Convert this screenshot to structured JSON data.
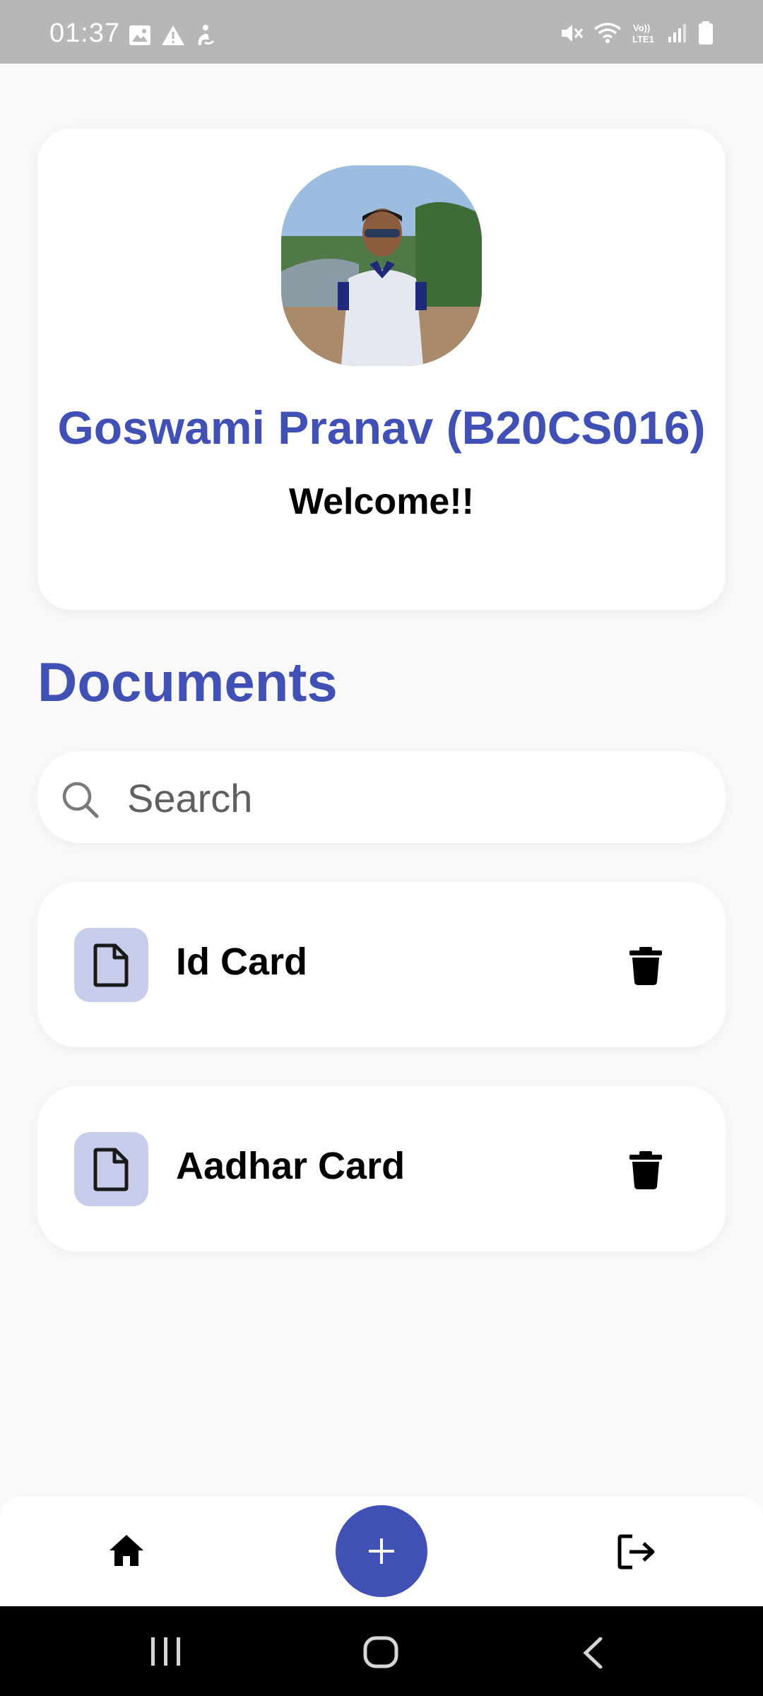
{
  "status_bar": {
    "time": "01:37",
    "left_icons": [
      "image-icon",
      "warning-icon",
      "accessibility-icon"
    ],
    "right_icons": [
      "mute-icon",
      "wifi-icon",
      "volte-icon",
      "signal-icon",
      "battery-icon"
    ],
    "volte_label": "Vo)) LTE1"
  },
  "profile": {
    "name": "Goswami Pranav (B20CS016)",
    "greeting": "Welcome!!"
  },
  "documents": {
    "heading": "Documents",
    "search": {
      "placeholder": "Search",
      "value": ""
    },
    "items": [
      {
        "label": "Id Card",
        "icon": "file-icon",
        "action_icon": "trash-icon"
      },
      {
        "label": "Aadhar Card",
        "icon": "file-icon",
        "action_icon": "trash-icon"
      }
    ]
  },
  "bottom_nav": {
    "items": [
      "home-icon",
      "add-icon",
      "logout-icon"
    ]
  },
  "colors": {
    "accent": "#4150b4",
    "icon_bg": "#c9cdec",
    "background": "#f9f9f9",
    "status_bar": "#b7b7b7"
  }
}
